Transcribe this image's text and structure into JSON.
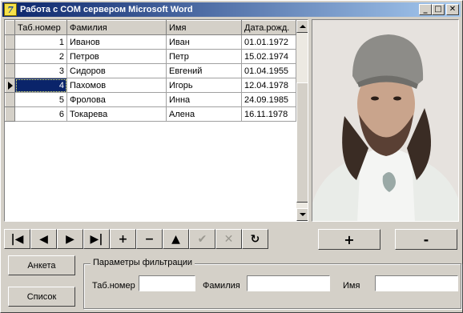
{
  "window": {
    "icon_letter": "7",
    "title": "Работа с COM сервером Microsoft Word",
    "controls": {
      "minimize": "_",
      "maximize": "□",
      "close": "✕"
    }
  },
  "grid": {
    "columns": [
      "Таб.номер",
      "Фамилия",
      "Имя",
      "Дата.рожд."
    ],
    "rows": [
      [
        "1",
        "Иванов",
        "Иван",
        "01.01.1972"
      ],
      [
        "2",
        "Петров",
        "Петр",
        "15.02.1974"
      ],
      [
        "3",
        "Сидоров",
        "Евгений",
        "01.04.1955"
      ],
      [
        "4",
        "Пахомов",
        "Игорь",
        "12.04.1978"
      ],
      [
        "5",
        "Фролова",
        "Инна",
        "24.09.1985"
      ],
      [
        "6",
        "Токарева",
        "Алена",
        "16.11.1978"
      ]
    ],
    "selected_row": 3
  },
  "navigator": [
    {
      "name": "first",
      "glyph": "|◀",
      "enabled": true
    },
    {
      "name": "prior",
      "glyph": "◀",
      "enabled": true
    },
    {
      "name": "next",
      "glyph": "▶",
      "enabled": true
    },
    {
      "name": "last",
      "glyph": "▶|",
      "enabled": true
    },
    {
      "name": "insert",
      "glyph": "+",
      "enabled": true
    },
    {
      "name": "delete",
      "glyph": "−",
      "enabled": true
    },
    {
      "name": "edit",
      "glyph": "▲",
      "enabled": true
    },
    {
      "name": "post",
      "glyph": "✔",
      "enabled": false
    },
    {
      "name": "cancel",
      "glyph": "✕",
      "enabled": false
    },
    {
      "name": "refresh",
      "glyph": "↻",
      "enabled": true
    }
  ],
  "photo_buttons": {
    "add": "+",
    "remove": "-"
  },
  "buttons": {
    "anketa": "Анкета",
    "spisok": "Список"
  },
  "filter": {
    "caption": "Параметры фильтрации",
    "tabnum_label": "Таб.номер",
    "tabnum_value": "",
    "surname_label": "Фамилия",
    "surname_value": "",
    "name_label": "Имя",
    "name_value": ""
  }
}
